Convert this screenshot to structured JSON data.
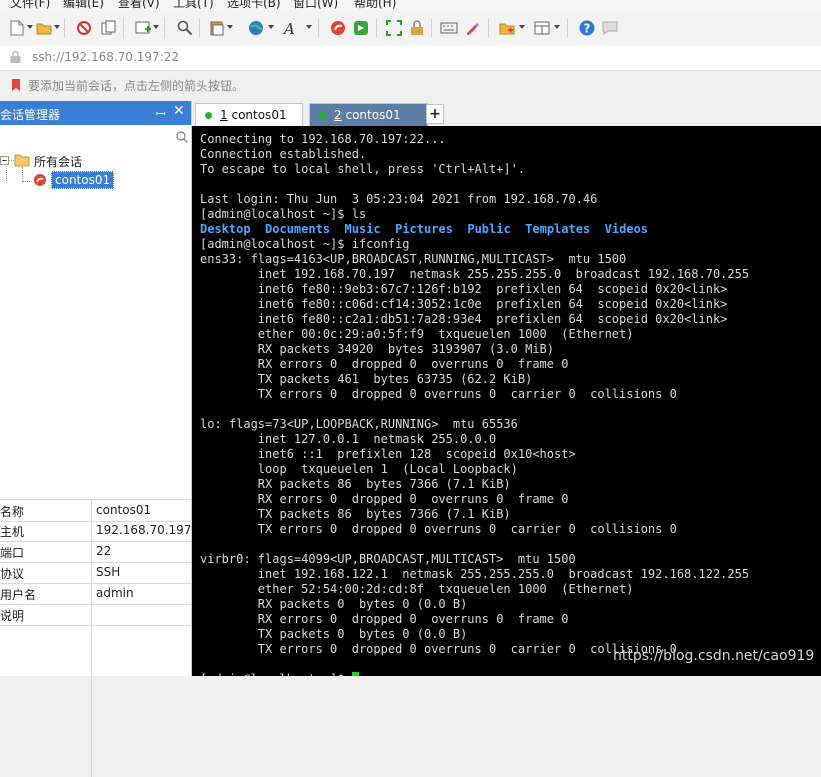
{
  "menu": {
    "items": [
      "文件(F)",
      "编辑(E)",
      "查看(V)",
      "工具(T)",
      "选项卡(B)",
      "窗口(W)",
      "帮助(H)"
    ]
  },
  "toolbar": {
    "icons": [
      "new-session-icon",
      "open-folder-icon",
      "disconnect-icon",
      "copy-icon",
      "new-tab-icon",
      "find-icon",
      "paste-icon",
      "globe-icon",
      "font-icon",
      "xshell-logo-icon",
      "xftp-icon",
      "fullscreen-icon",
      "lock-icon",
      "keyboard-icon",
      "highlight-icon",
      "layout-icon",
      "tile-icon",
      "help-icon",
      "chat-icon"
    ]
  },
  "address": {
    "text": "ssh://192.168.70.197:22"
  },
  "hint": {
    "text": "要添加当前会话，点击左侧的箭头按钮。"
  },
  "session_panel": {
    "title": "会话管理器",
    "tree": {
      "root": "所有会话",
      "child": "contos01"
    },
    "properties": [
      {
        "key": "名称",
        "value": "contos01"
      },
      {
        "key": "主机",
        "value": "192.168.70.197"
      },
      {
        "key": "端口",
        "value": "22"
      },
      {
        "key": "协议",
        "value": "SSH"
      },
      {
        "key": "用户名",
        "value": "admin"
      },
      {
        "key": "说明",
        "value": ""
      }
    ]
  },
  "tabs": [
    {
      "number": "1",
      "name": "contos01"
    },
    {
      "number": "2",
      "name": "contos01"
    }
  ],
  "terminal": {
    "lines": [
      "Connecting to 192.168.70.197:22...",
      "Connection established.",
      "To escape to local shell, press 'Ctrl+Alt+]'.",
      "",
      "Last login: Thu Jun  3 05:23:04 2021 from 192.168.70.46",
      "[admin@localhost ~]$ ls",
      "",
      "[admin@localhost ~]$ ifconfig",
      "ens33: flags=4163<UP,BROADCAST,RUNNING,MULTICAST>  mtu 1500",
      "        inet 192.168.70.197  netmask 255.255.255.0  broadcast 192.168.70.255",
      "        inet6 fe80::9eb3:67c7:126f:b192  prefixlen 64  scopeid 0x20<link>",
      "        inet6 fe80::c06d:cf14:3052:1c0e  prefixlen 64  scopeid 0x20<link>",
      "        inet6 fe80::c2a1:db51:7a28:93e4  prefixlen 64  scopeid 0x20<link>",
      "        ether 00:0c:29:a0:5f:f9  txqueuelen 1000  (Ethernet)",
      "        RX packets 34920  bytes 3193907 (3.0 MiB)",
      "        RX errors 0  dropped 0  overruns 0  frame 0",
      "        TX packets 461  bytes 63735 (62.2 KiB)",
      "        TX errors 0  dropped 0 overruns 0  carrier 0  collisions 0",
      "",
      "lo: flags=73<UP,LOOPBACK,RUNNING>  mtu 65536",
      "        inet 127.0.0.1  netmask 255.0.0.0",
      "        inet6 ::1  prefixlen 128  scopeid 0x10<host>",
      "        loop  txqueuelen 1  (Local Loopback)",
      "        RX packets 86  bytes 7366 (7.1 KiB)",
      "        RX errors 0  dropped 0  overruns 0  frame 0",
      "        TX packets 86  bytes 7366 (7.1 KiB)",
      "        TX errors 0  dropped 0 overruns 0  carrier 0  collisions 0",
      "",
      "virbr0: flags=4099<UP,BROADCAST,MULTICAST>  mtu 1500",
      "        inet 192.168.122.1  netmask 255.255.255.0  broadcast 192.168.122.255",
      "        ether 52:54:00:2d:cd:8f  txqueuelen 1000  (Ethernet)",
      "        RX packets 0  bytes 0 (0.0 B)",
      "        RX errors 0  dropped 0  overruns 0  frame 0",
      "        TX packets 0  bytes 0 (0.0 B)",
      "        TX errors 0  dropped 0 overruns 0  carrier 0  collisions 0",
      "",
      "[admin@localhost ~]$ "
    ],
    "ls_output": [
      "Desktop",
      "Documents",
      "Music",
      "Pictures",
      "Public",
      "Templates",
      "Videos"
    ]
  },
  "watermark": {
    "text": "https://blog.csdn.net/cao919"
  },
  "colors": {
    "accent": "#3b7ed6",
    "active_tab": "#5c7da6",
    "terminal_bg": "#000000",
    "dir_blue": "#4aa8ff",
    "cursor": "#1fd41f"
  }
}
